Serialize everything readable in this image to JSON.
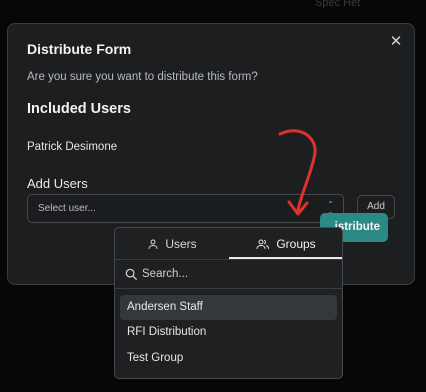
{
  "background": {
    "partial_text": "Spec Het"
  },
  "modal": {
    "title": "Distribute Form",
    "close_glyph": "✕",
    "subtitle": "Are you sure you want to distribute this form?",
    "included_users_title": "Included Users",
    "included_users": [
      "Patrick Desimone"
    ],
    "add_users_label": "Add Users",
    "select_placeholder": "Select user...",
    "add_button": "Add",
    "distribute_button": "istribute"
  },
  "dropdown": {
    "tabs": [
      {
        "label": "Users",
        "icon": "user-icon",
        "selected": false
      },
      {
        "label": "Groups",
        "icon": "users-group-icon",
        "selected": true
      }
    ],
    "search_placeholder": "Search...",
    "options": [
      {
        "label": "Andersen Staff",
        "highlighted": true
      },
      {
        "label": "RFI Distribution",
        "highlighted": false
      },
      {
        "label": "Test Group",
        "highlighted": false
      }
    ]
  },
  "colors": {
    "accent": "#2a8a86",
    "annotation_arrow": "#e0322c",
    "modal_bg": "#1c1e20"
  }
}
